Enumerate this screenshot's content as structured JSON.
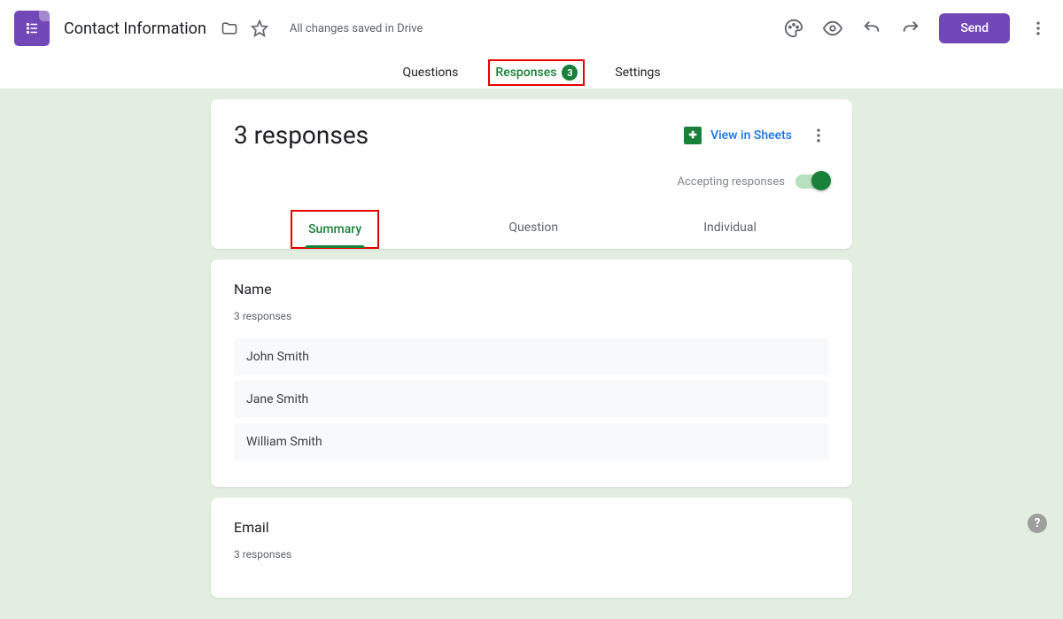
{
  "header": {
    "form_title": "Contact Information",
    "save_status": "All changes saved in Drive",
    "send_label": "Send"
  },
  "main_tabs": {
    "questions": "Questions",
    "responses": "Responses",
    "responses_badge": "3",
    "settings": "Settings"
  },
  "responses_card": {
    "title": "3 responses",
    "view_sheets": "View in Sheets",
    "accepting_label": "Accepting responses",
    "sub_tabs": {
      "summary": "Summary",
      "question": "Question",
      "individual": "Individual"
    }
  },
  "questions": [
    {
      "title": "Name",
      "subtitle": "3 responses",
      "answers": [
        "John Smith",
        "Jane Smith",
        "William Smith"
      ]
    },
    {
      "title": "Email",
      "subtitle": "3 responses"
    }
  ]
}
